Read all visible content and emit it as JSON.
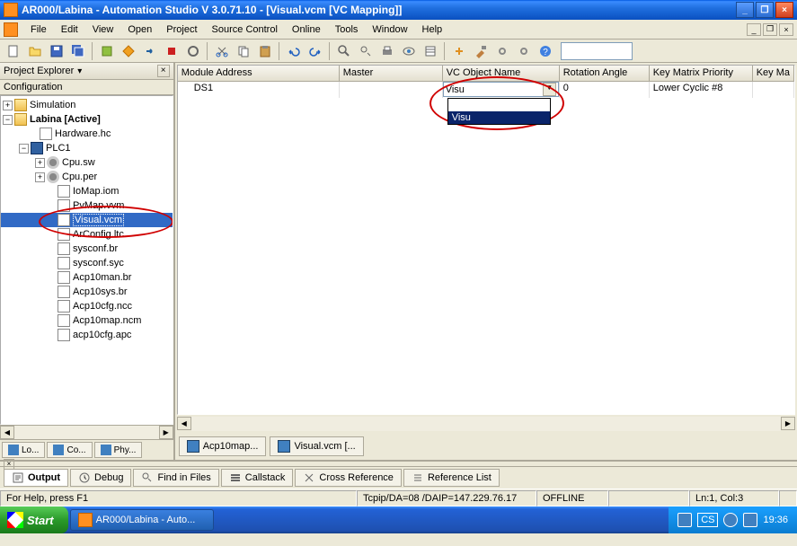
{
  "title": "AR000/Labina - Automation Studio V 3.0.71.10 - [Visual.vcm [VC Mapping]]",
  "menus": [
    "File",
    "Edit",
    "View",
    "Open",
    "Project",
    "Source Control",
    "Online",
    "Tools",
    "Window",
    "Help"
  ],
  "project_explorer": {
    "title": "Project Explorer",
    "config_label": "Configuration",
    "tabs": [
      "Lo...",
      "Co...",
      "Phy..."
    ]
  },
  "tree": {
    "simulation": "Simulation",
    "labina": "Labina [Active]",
    "hardware": "Hardware.hc",
    "plc1": "PLC1",
    "items": [
      "Cpu.sw",
      "Cpu.per",
      "IoMap.iom",
      "PvMap.vvm",
      "Visual.vcm",
      "ArConfig.ltc",
      "sysconf.br",
      "sysconf.syc",
      "Acp10man.br",
      "Acp10sys.br",
      "Acp10cfg.ncc",
      "Acp10map.ncm",
      "acp10cfg.apc"
    ]
  },
  "grid": {
    "headers": [
      "Module Address",
      "Master",
      "VC Object Name",
      "Rotation Angle",
      "Key Matrix Priority",
      "Key Ma"
    ],
    "row": {
      "module_address": "DS1",
      "master": "",
      "vc_object": "Visu",
      "rotation": "0",
      "key_matrix": "Lower Cyclic #8"
    },
    "dropdown_options": [
      "",
      "Visu"
    ]
  },
  "doc_tabs": [
    "Acp10map...",
    "Visual.vcm [..."
  ],
  "bottom_tabs": [
    "Output",
    "Debug",
    "Find in Files",
    "Callstack",
    "Cross Reference",
    "Reference List"
  ],
  "status": {
    "help": "For Help, press F1",
    "tcpip": "Tcpip/DA=08 /DAIP=147.229.76.17",
    "offline": "OFFLINE",
    "pos": "Ln:1, Col:3"
  },
  "taskbar": {
    "start": "Start",
    "task": "AR000/Labina - Auto...",
    "lang": "CS",
    "time": "19:36"
  }
}
